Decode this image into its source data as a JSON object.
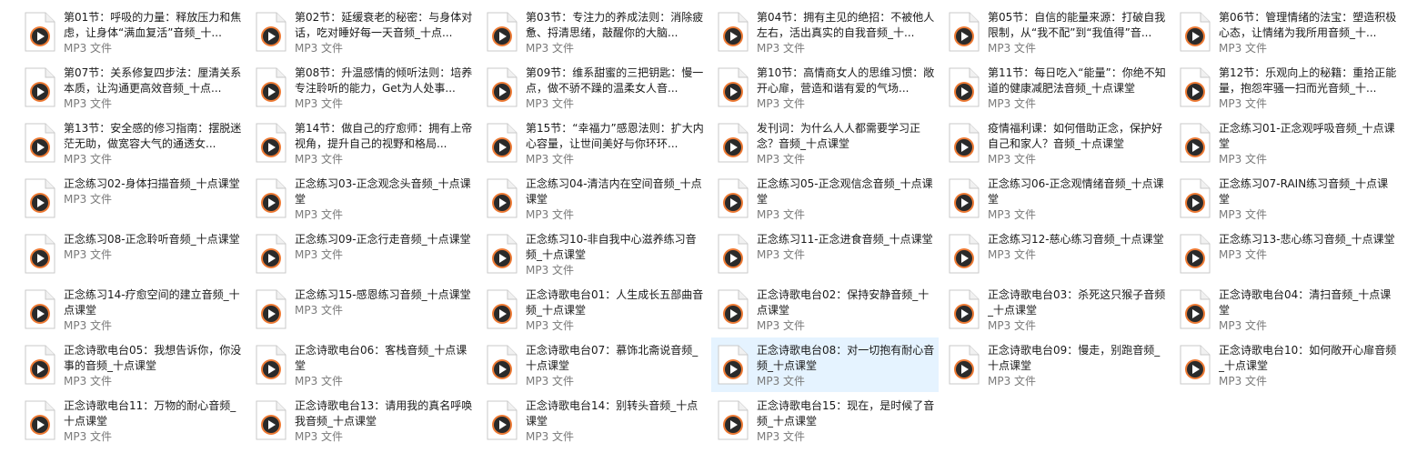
{
  "file_type_label": "MP3 文件",
  "file_icon": "mp3-media-file-icon",
  "colors": {
    "selected_bg": "#e5f3ff",
    "type_text": "#7a7a7a",
    "icon_ring": "#e8743b"
  },
  "files": [
    {
      "name": "第01节：呼吸的力量：释放压力和焦虑，让身体“满血复活”音频_十..."
    },
    {
      "name": "第02节：延缓衰老的秘密：与身体对话，吃对睡好每一天音频_十点..."
    },
    {
      "name": "第03节：专注力的养成法则：消除疲惫、捋清思绪，敲醒你的大脑..."
    },
    {
      "name": "第04节：拥有主见的绝招：不被他人左右，活出真实的自我音频_十..."
    },
    {
      "name": "第05节：自信的能量来源：打破自我限制，从“我不配”到“我值得”音..."
    },
    {
      "name": "第06节：管理情绪的法宝：塑造积极心态，让情绪为我所用音频_十..."
    },
    {
      "name": "第07节：关系修复四步法：厘清关系本质，让沟通更高效音频_十点..."
    },
    {
      "name": "第08节：升温感情的倾听法则：培养专注聆听的能力，Get为人处事..."
    },
    {
      "name": "第09节：维系甜蜜的三把钥匙：慢一点，做不骄不躁的温柔女人音..."
    },
    {
      "name": "第10节：高情商女人的思维习惯：敞开心扉，营造和谐有爱的气场..."
    },
    {
      "name": "第11节：每日吃入“能量”：你绝不知道的健康减肥法音频_十点课堂"
    },
    {
      "name": "第12节：乐观向上的秘籍：重拾正能量，抱怨牢骚一扫而光音频_十..."
    },
    {
      "name": "第13节：安全感的修习指南：摆脱迷茫无助，做宽容大气的通透女..."
    },
    {
      "name": "第14节：做自己的疗愈师：拥有上帝视角，提升自己的视野和格局..."
    },
    {
      "name": "第15节：“幸福力”感恩法则：扩大内心容量，让世间美好与你环环..."
    },
    {
      "name": "发刊词：为什么人人都需要学习正念？音频_十点课堂"
    },
    {
      "name": "疫情福利课：如何借助正念，保护好自己和家人？音频_十点课堂"
    },
    {
      "name": "正念练习01-正念观呼吸音频_十点课堂"
    },
    {
      "name": "正念练习02-身体扫描音频_十点课堂"
    },
    {
      "name": "正念练习03-正念观念头音频_十点课堂"
    },
    {
      "name": "正念练习04-清洁内在空间音频_十点课堂"
    },
    {
      "name": "正念练习05-正念观信念音频_十点课堂"
    },
    {
      "name": "正念练习06-正念观情绪音频_十点课堂"
    },
    {
      "name": "正念练习07-RAIN练习音频_十点课堂"
    },
    {
      "name": "正念练习08-正念聆听音频_十点课堂"
    },
    {
      "name": "正念练习09-正念行走音频_十点课堂"
    },
    {
      "name": "正念练习10-非自我中心滋养练习音频_十点课堂"
    },
    {
      "name": "正念练习11-正念进食音频_十点课堂"
    },
    {
      "name": "正念练习12-慈心练习音频_十点课堂"
    },
    {
      "name": "正念练习13-悲心练习音频_十点课堂"
    },
    {
      "name": "正念练习14-疗愈空间的建立音频_十点课堂"
    },
    {
      "name": "正念练习15-感恩练习音频_十点课堂"
    },
    {
      "name": "正念诗歌电台01：人生成长五部曲音频_十点课堂"
    },
    {
      "name": "正念诗歌电台02：保持安静音频_十点课堂"
    },
    {
      "name": "正念诗歌电台03：杀死这只猴子音频_十点课堂"
    },
    {
      "name": "正念诗歌电台04：清扫音频_十点课堂"
    },
    {
      "name": "正念诗歌电台05：我想告诉你，你没事的音频_十点课堂"
    },
    {
      "name": "正念诗歌电台06：客栈音频_十点课堂"
    },
    {
      "name": "正念诗歌电台07：慕饰北斋说音频_十点课堂"
    },
    {
      "name": "正念诗歌电台08：对一切抱有耐心音频_十点课堂",
      "selected": true
    },
    {
      "name": "正念诗歌电台09：慢走，别跑音频_十点课堂"
    },
    {
      "name": "正念诗歌电台10：如何敞开心扉音频_十点课堂"
    },
    {
      "name": "正念诗歌电台11：万物的耐心音频_十点课堂"
    },
    {
      "name": "正念诗歌电台13：请用我的真名呼唤我音频_十点课堂"
    },
    {
      "name": "正念诗歌电台14：别转头音频_十点课堂"
    },
    {
      "name": "正念诗歌电台15：现在，是时候了音频_十点课堂"
    }
  ]
}
